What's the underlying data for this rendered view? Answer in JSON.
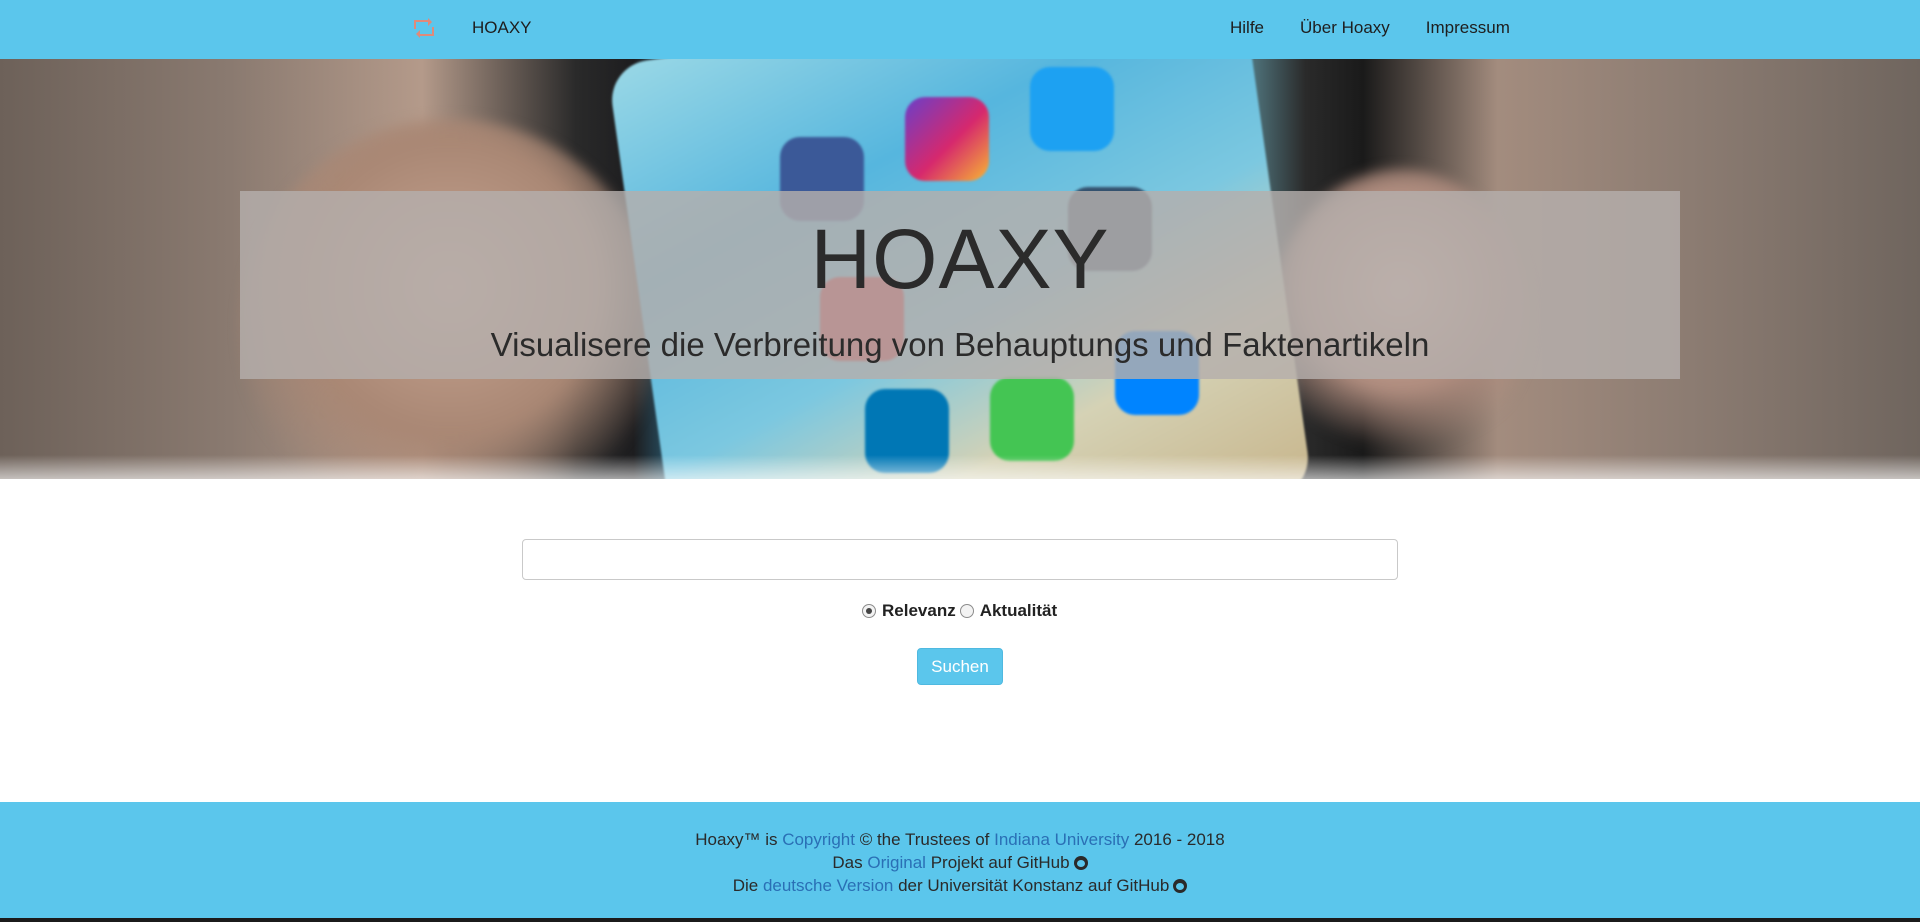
{
  "navbar": {
    "brand_icon": "retweet-icon",
    "brand": "HOAXY",
    "links": [
      "Hilfe",
      "Über Hoaxy",
      "Impressum"
    ]
  },
  "hero": {
    "title": "HOAXY",
    "subtitle": "Visualisere die Verbreitung von Behauptungs und Faktenartikeln"
  },
  "search": {
    "input_value": "",
    "sort_options": [
      {
        "label": "Relevanz",
        "checked": true
      },
      {
        "label": "Aktualität",
        "checked": false
      }
    ],
    "button_label": "Suchen"
  },
  "footer": {
    "line1": {
      "prefix": "Hoaxy™ is ",
      "link1": "Copyright",
      "middle": " © the Trustees of ",
      "link2": "Indiana University",
      "suffix": " 2016 - 2018"
    },
    "line2": {
      "prefix": "Das ",
      "link": "Original",
      "suffix": " Projekt auf GitHub"
    },
    "line3": {
      "prefix": "Die ",
      "link": "deutsche Version",
      "suffix": " der Universität Konstanz auf GitHub"
    },
    "github_icon": "github-icon"
  },
  "colors": {
    "accent": "#5bc6ec",
    "link": "#2a6fb5"
  }
}
